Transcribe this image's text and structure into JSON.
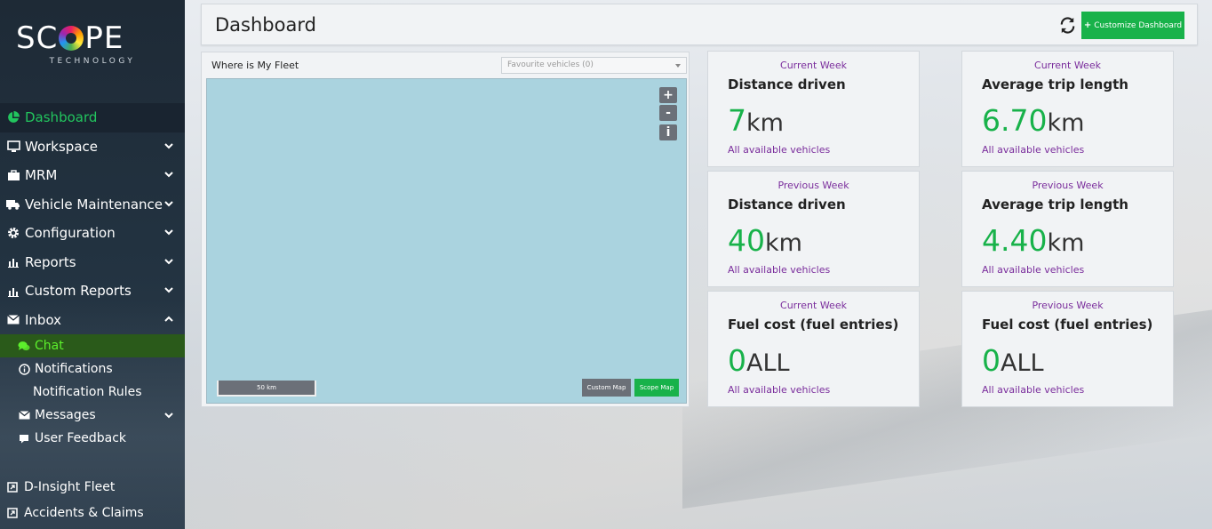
{
  "logo": {
    "name": "SCOPE",
    "tagline": "TECHNOLOGY"
  },
  "sidebar": {
    "items": [
      {
        "label": "Dashboard"
      },
      {
        "label": "Workspace"
      },
      {
        "label": "MRM"
      },
      {
        "label": "Vehicle Maintenance"
      },
      {
        "label": "Configuration"
      },
      {
        "label": "Reports"
      },
      {
        "label": "Custom Reports"
      },
      {
        "label": "Inbox"
      }
    ],
    "inbox_sub": [
      {
        "label": "Chat"
      },
      {
        "label": "Notifications"
      },
      {
        "label": "Notification Rules"
      },
      {
        "label": "Messages"
      },
      {
        "label": "User Feedback"
      }
    ],
    "bottom": [
      {
        "label": "D-Insight Fleet"
      },
      {
        "label": "Accidents & Claims"
      }
    ]
  },
  "header": {
    "title": "Dashboard",
    "customize_label": "Customize Dashboard"
  },
  "map": {
    "title": "Where is My Fleet",
    "select_value": "Favourite vehicles (0)",
    "zoom_in": "+",
    "zoom_out": "-",
    "info": "i",
    "scale": "50 km",
    "custom_map": "Custom Map",
    "scope_map": "Scope Map"
  },
  "cards": [
    {
      "period": "Current Week",
      "title": "Distance driven",
      "value": "7",
      "unit": "km",
      "footer": "All available vehicles"
    },
    {
      "period": "Current Week",
      "title": "Average trip length",
      "value": "6.70",
      "unit": "km",
      "footer": "All available vehicles"
    },
    {
      "period": "Previous Week",
      "title": "Distance driven",
      "value": "40",
      "unit": "km",
      "footer": "All available vehicles"
    },
    {
      "period": "Previous Week",
      "title": "Average trip length",
      "value": "4.40",
      "unit": "km",
      "footer": "All available vehicles"
    },
    {
      "period": "Current Week",
      "title": "Fuel cost (fuel entries)",
      "value": "0",
      "unit": "ALL",
      "footer": "All available vehicles"
    },
    {
      "period": "Previous Week",
      "title": "Fuel cost (fuel entries)",
      "value": "0",
      "unit": "ALL",
      "footer": "All available vehicles"
    }
  ],
  "colors": {
    "accent": "#18b24a",
    "purple": "#7a2d9c",
    "map_water": "#aad3df"
  }
}
